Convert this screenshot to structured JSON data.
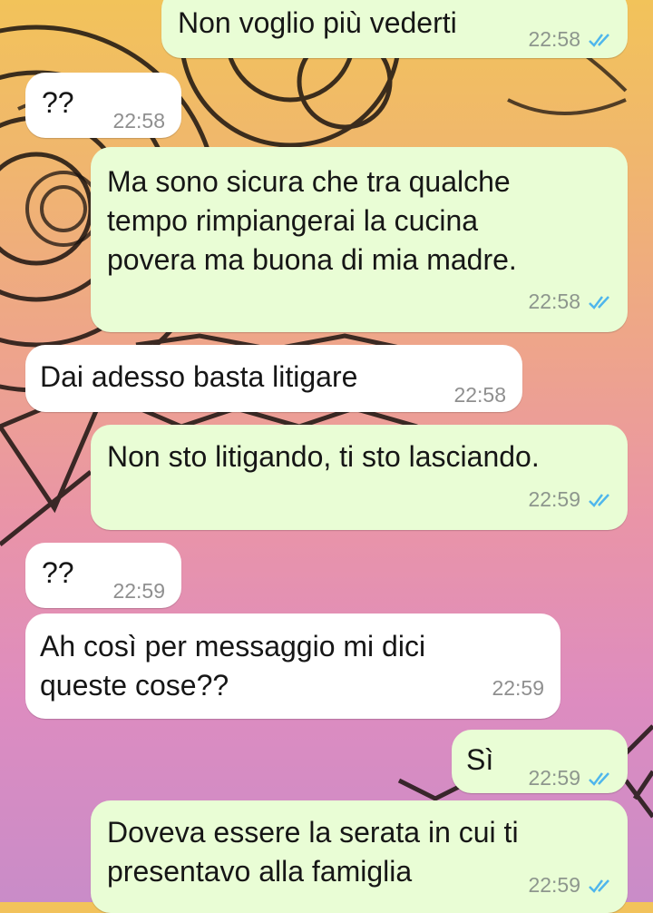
{
  "colors": {
    "outgoing_bubble": "#e9fdd5",
    "incoming_bubble": "#ffffff",
    "read_ticks": "#4fb6ec"
  },
  "messages": [
    {
      "direction": "outgoing",
      "text": "Non voglio più vederti",
      "time": "22:58",
      "status": "read-ticks-icon"
    },
    {
      "direction": "incoming",
      "text": "??",
      "time": "22:58"
    },
    {
      "direction": "outgoing",
      "text": "Ma sono sicura che tra qualche\ntempo rimpiangerai la cucina\npovera ma buona di mia madre.",
      "time": "22:58",
      "status": "read-ticks-icon"
    },
    {
      "direction": "incoming",
      "text": "Dai adesso basta litigare",
      "time": "22:58"
    },
    {
      "direction": "outgoing",
      "text": "Non sto litigando, ti sto lasciando.",
      "time": "22:59",
      "status": "read-ticks-icon"
    },
    {
      "direction": "incoming",
      "text": "??",
      "time": "22:59"
    },
    {
      "direction": "incoming",
      "text": "Ah così per messaggio mi dici\nqueste cose??",
      "time": "22:59"
    },
    {
      "direction": "outgoing",
      "text": "Sì",
      "time": "22:59",
      "status": "read-ticks-icon"
    },
    {
      "direction": "outgoing",
      "text": "Doveva essere la serata in cui ti\npresentavo alla famiglia",
      "time": "22:59",
      "status": "read-ticks-icon"
    }
  ]
}
